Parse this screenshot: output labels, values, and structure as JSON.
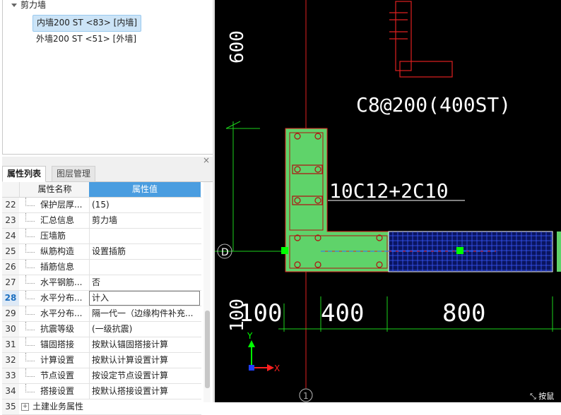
{
  "tree": {
    "root": "剪力墙",
    "items": [
      {
        "label": "内墙200 ST <83> [内墙]",
        "selected": true
      },
      {
        "label": "外墙200 ST <51> [外墙]",
        "selected": false
      }
    ]
  },
  "tabs": {
    "properties": "属性列表",
    "layers": "图层管理"
  },
  "grid": {
    "header_name": "属性名称",
    "header_value": "属性值",
    "rows": [
      {
        "num": "22",
        "name": "保护层厚...",
        "value": "(15)"
      },
      {
        "num": "23",
        "name": "汇总信息",
        "value": "剪力墙"
      },
      {
        "num": "24",
        "name": "压墙筋",
        "value": ""
      },
      {
        "num": "25",
        "name": "纵筋构造",
        "value": "设置插筋"
      },
      {
        "num": "26",
        "name": "插筋信息",
        "value": ""
      },
      {
        "num": "27",
        "name": "水平钢筋...",
        "value": "否"
      },
      {
        "num": "28",
        "name": "水平分布...",
        "value": "计入"
      },
      {
        "num": "29",
        "name": "水平分布...",
        "value": "隔一代一（边缘构件补充..."
      },
      {
        "num": "30",
        "name": "抗震等级",
        "value": "(一级抗震)"
      },
      {
        "num": "31",
        "name": "锚固搭接",
        "value": "按默认锚固搭接计算"
      },
      {
        "num": "32",
        "name": "计算设置",
        "value": "按默认计算设置计算"
      },
      {
        "num": "33",
        "name": "节点设置",
        "value": "按设定节点设置计算"
      },
      {
        "num": "34",
        "name": "搭接设置",
        "value": "按默认搭接设置计算"
      },
      {
        "num": "35",
        "name": "土建业务属性",
        "value": ""
      }
    ]
  },
  "cad": {
    "stirrup_label": "C8@200(400ST)",
    "rebar_label": "10C12+2C10",
    "dim_1": "100",
    "dim_2": "400",
    "dim_3": "800",
    "vert_dim_top": "600",
    "vert_dim_bottom": "100",
    "axis_label": "D",
    "axis_num": "1",
    "ucs_x": "X",
    "ucs_y": "Y",
    "status_text": "按鼠"
  },
  "colors": {
    "wall_green": "#5fd36a",
    "grid_blue": "#3b5bff",
    "dim_green": "#1cd21c",
    "rebar_red": "#e02020",
    "selection_blue": "#cce4f7",
    "header_blue": "#4a9de0"
  }
}
